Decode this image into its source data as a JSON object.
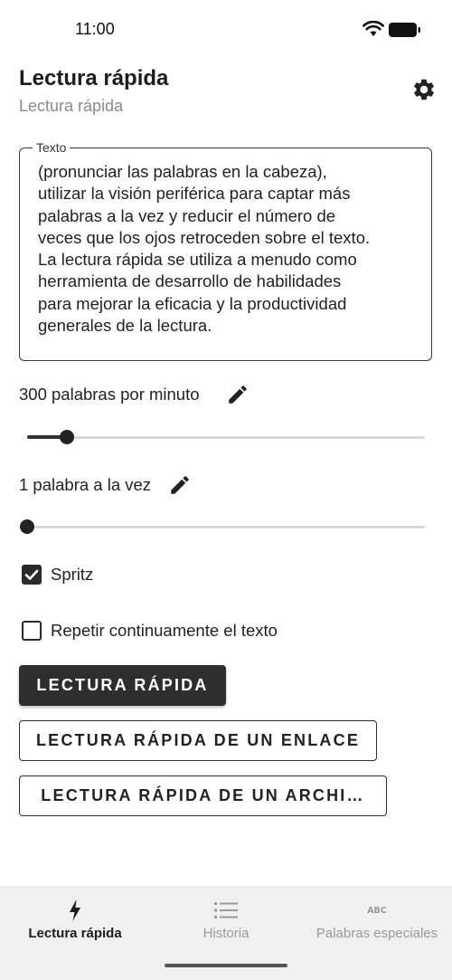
{
  "status_bar": {
    "time": "11:00"
  },
  "header": {
    "title": "Lectura rápida",
    "subtitle": "Lectura rápida"
  },
  "text_field": {
    "label": "Texto",
    "lines": [
      "(pronunciar las palabras en la cabeza),",
      "utilizar la visión periférica para captar más",
      "palabras a la vez y reducir el número de",
      "veces que los ojos retroceden sobre el texto.",
      "La lectura rápida se utiliza a menudo como",
      "herramienta de desarrollo de habilidades",
      "para mejorar la eficacia y la productividad",
      "generales de la lectura."
    ]
  },
  "speed": {
    "label": "300 palabras por minuto",
    "slider_fraction": 0.1
  },
  "words_at_once": {
    "label": "1 palabra a la vez",
    "slider_fraction": 0.0
  },
  "checkboxes": {
    "spritz": {
      "label": "Spritz",
      "checked": true
    },
    "repeat": {
      "label": "Repetir continuamente el texto",
      "checked": false
    }
  },
  "buttons": {
    "speed_read": "LECTURA RÁPIDA",
    "speed_read_link": "LECTURA RÁPIDA DE UN ENLACE",
    "speed_read_file": "LECTURA RÁPIDA DE UN ARCHI…"
  },
  "bottom_nav": {
    "items": [
      {
        "label": "Lectura rápida",
        "icon": "lightning-bolt-icon",
        "active": true
      },
      {
        "label": "Historia",
        "icon": "list-icon",
        "active": false
      },
      {
        "label": "Palabras especiales",
        "icon": "abc-icon",
        "active": false
      }
    ]
  },
  "colors": {
    "primary": "#2e2e2e",
    "inactive": "#9a9a9a",
    "nav_background": "#f0f0f0"
  }
}
